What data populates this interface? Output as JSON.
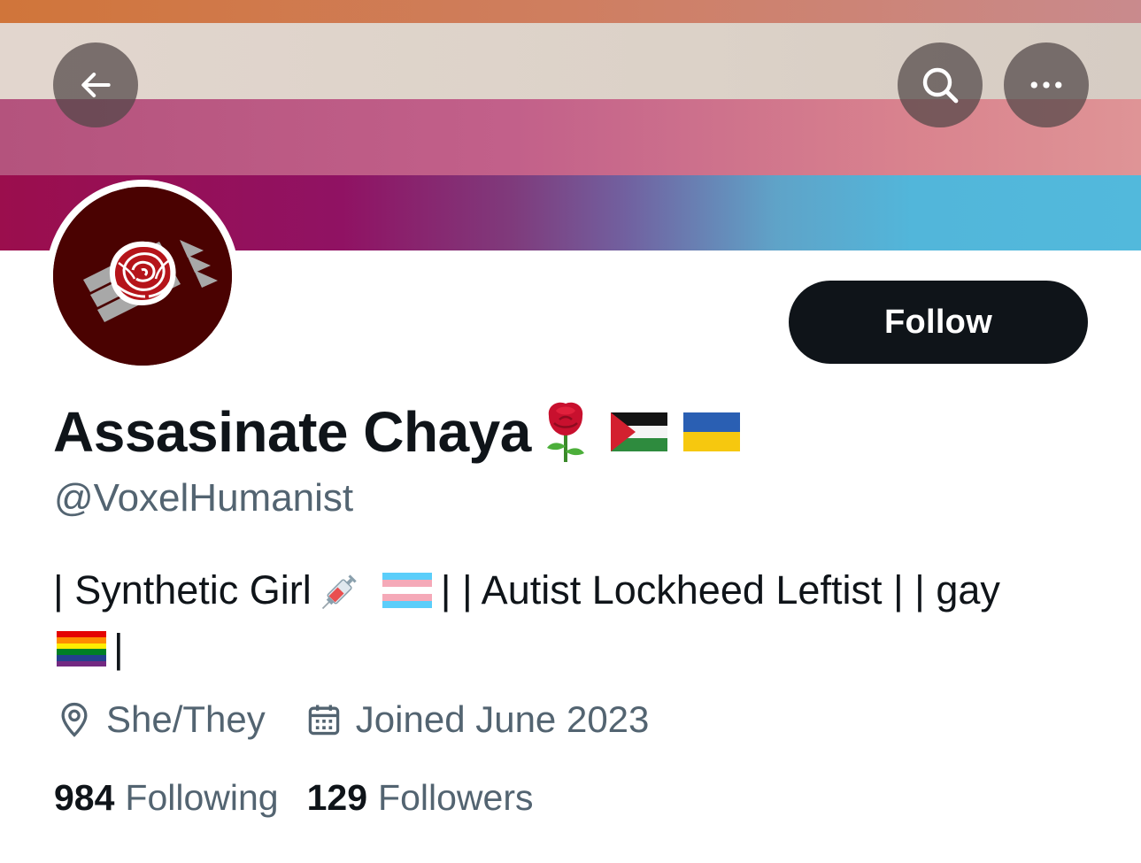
{
  "header": {
    "back_icon": "arrow-left-icon",
    "search_icon": "search-icon",
    "more_icon": "more-horizontal-icon"
  },
  "banner": {
    "colors": [
      "#d0753a",
      "#e2d6ce",
      "#c2608a",
      "#9b0e4d",
      "#52b6da"
    ]
  },
  "avatar": {
    "icon": "rose-logo-icon",
    "background": "#4a0201"
  },
  "follow_button": {
    "label": "Follow"
  },
  "profile": {
    "display_name": "Assasinate Chaya",
    "name_emojis": [
      "rose-emoji",
      "palestine-flag-emoji",
      "ukraine-flag-emoji"
    ],
    "handle": "@VoxelHumanist",
    "bio": {
      "segment_1": "| Synthetic Girl",
      "segment_2": "| | Autist Lockheed Leftist | | gay",
      "segment_3": "|",
      "emojis": [
        "syringe-emoji",
        "trans-flag-emoji",
        "rainbow-flag-emoji"
      ]
    },
    "pronouns": "She/They",
    "joined": "Joined June 2023"
  },
  "stats": {
    "following_count": "984",
    "following_label": "Following",
    "followers_count": "129",
    "followers_label": "Followers"
  },
  "colors": {
    "text_primary": "#0f1419",
    "text_secondary": "#536471",
    "button_bg": "#0f1419"
  }
}
